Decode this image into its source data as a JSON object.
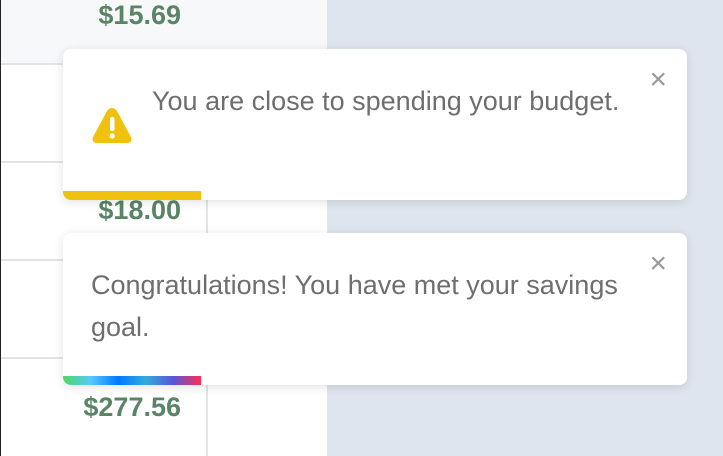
{
  "table": {
    "amounts": [
      "$15.69",
      "$18.00",
      "$277.56"
    ]
  },
  "toasts": [
    {
      "type": "warning",
      "icon": "warning-triangle-icon",
      "message": "You are close to spending your budget.",
      "close": "×",
      "color": "#f0c20f"
    },
    {
      "type": "success",
      "message": "Congratulations! You have met your savings goal.",
      "close": "×"
    }
  ]
}
